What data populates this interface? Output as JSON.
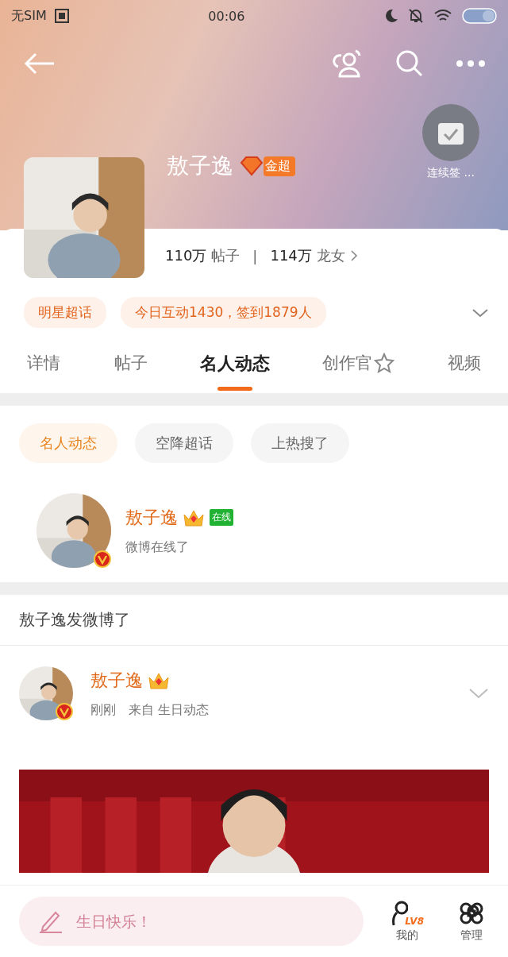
{
  "status_bar": {
    "carrier": "无SIM",
    "time": "00:06"
  },
  "profile": {
    "name": "敖子逸",
    "badge": "金超",
    "checkin_label": "连续签 ...",
    "stats_separator": "|",
    "stats": [
      {
        "value": "110万",
        "label": "帖子"
      },
      {
        "value": "114万",
        "label": "龙女"
      }
    ]
  },
  "tags": [
    "明星超话",
    "今日互动1430，签到1879人"
  ],
  "tabs": [
    {
      "label": "详情",
      "selected": false
    },
    {
      "label": "帖子",
      "selected": false
    },
    {
      "label": "名人动态",
      "selected": true
    },
    {
      "label": "创作官",
      "selected": false,
      "icon": true
    },
    {
      "label": "视频",
      "selected": false
    }
  ],
  "filters": [
    {
      "label": "名人动态",
      "selected": true
    },
    {
      "label": "空降超话",
      "selected": false
    },
    {
      "label": "上热搜了",
      "selected": false
    }
  ],
  "online_user": {
    "name": "敖子逸",
    "online_badge": "在线",
    "status": "微博在线了"
  },
  "section_title": "敖子逸发微博了",
  "post": {
    "name": "敖子逸",
    "time": "刚刚",
    "source": "来自 生日动态"
  },
  "bottom_bar": {
    "placeholder": "生日快乐！",
    "actions": [
      {
        "label": "我的",
        "level": "LV8"
      },
      {
        "label": "管理"
      }
    ]
  }
}
